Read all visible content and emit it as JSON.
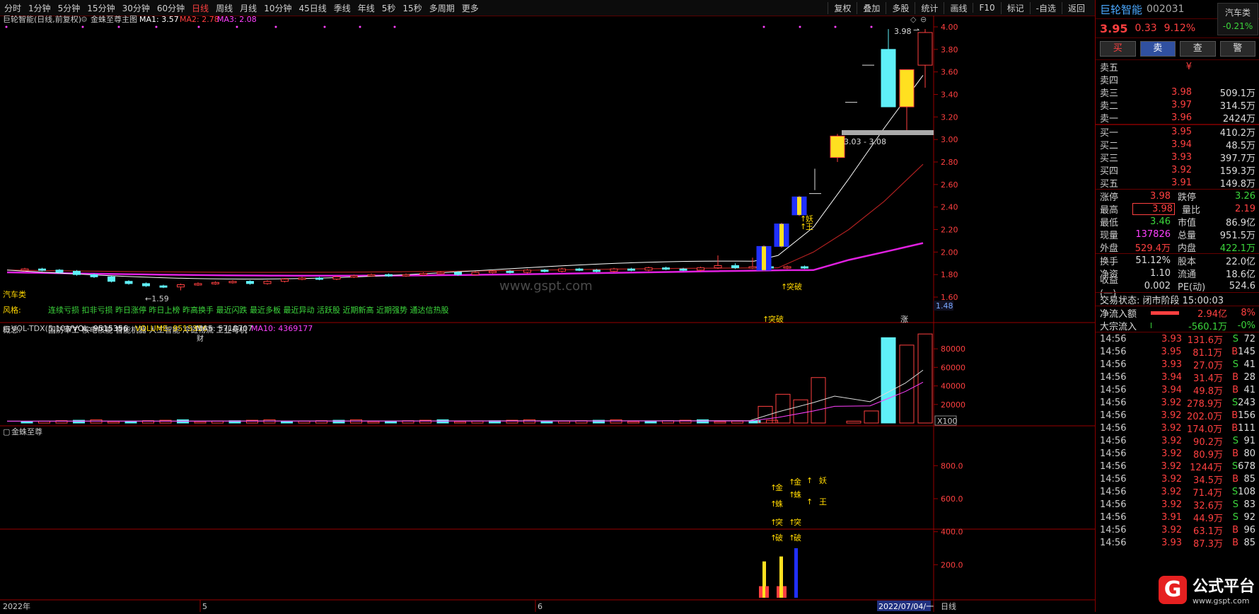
{
  "toolbar": {
    "tabs": [
      "分时",
      "1分钟",
      "5分钟",
      "15分钟",
      "30分钟",
      "60分钟",
      "日线",
      "周线",
      "月线",
      "10分钟",
      "45日线",
      "季线",
      "年线",
      "5秒",
      "15秒",
      "多周期",
      "更多"
    ],
    "active_tab": "日线",
    "tools": [
      "复权",
      "叠加",
      "多股",
      "统计",
      "画线",
      "F10",
      "标记",
      "-自选",
      "返回"
    ]
  },
  "main_chart": {
    "title": "巨轮智能(日线,前复权)",
    "indicator": "金蛛至尊主图",
    "ma1": "MA1: 3.57",
    "ma2": "MA2: 2.78",
    "ma3": "MA3: 2.08",
    "price_axis": [
      "4.00",
      "3.80",
      "3.60",
      "3.40",
      "3.20",
      "3.00",
      "2.80",
      "2.60",
      "2.40",
      "2.20",
      "2.00",
      "1.80",
      "1.60"
    ],
    "axis_low": "1.48",
    "peak_label": "3.98",
    "low_label": "←1.59",
    "range_label": "3.03 - 3.08",
    "sector_label": "汽车类",
    "style_label": "风格:",
    "style_tags": "连续亏损 扣非亏损 昨日涨停 昨日上榜 昨高换手 最近闪跌 最近多板 最近异动 活跃股 近期新高 近期强势 通达信热股",
    "concept_label": "概念:",
    "concept_tags": "国防军工 核电核能 智能机器 人工智能 冷链物流 工业母机",
    "concept_extra": "财",
    "signal_breakout": "突破",
    "signal_demon": "妖",
    "signal_king": "王",
    "signal_rise": "涨",
    "watermark": "www.gspt.com"
  },
  "volume_chart": {
    "title": "VOL-TDX(5,10)",
    "vvol": "VVOL: 9515356",
    "volume": "VOLUME: 9515356",
    "ma5": "MA5: 5718707",
    "ma10": "MA10: 4369177",
    "axis": [
      "80000",
      "60000",
      "40000",
      "20000"
    ],
    "unit": "X100"
  },
  "lower_chart": {
    "title": "金蛛至尊",
    "axis": [
      "800.0",
      "600.0",
      "400.0",
      "200.0"
    ],
    "sig_jin": "金",
    "sig_zhu": "蛛",
    "sig_tu": "突",
    "sig_po": "破",
    "sig_yao": "妖",
    "sig_wang": "王"
  },
  "date_axis": {
    "start": "2022年",
    "m5": "5",
    "m6": "6",
    "end": "2022/07/04/一",
    "period": "日线"
  },
  "stock": {
    "name": "巨轮智能",
    "code": "002031",
    "price": "3.95",
    "change": "0.33",
    "pct": "9.12%",
    "sector": "汽车类",
    "sector_pct": "-0.21%"
  },
  "trade_buttons": [
    "买",
    "卖",
    "查",
    "警"
  ],
  "order_book": {
    "sell": [
      {
        "label": "卖五",
        "price": "¥",
        "vol": ""
      },
      {
        "label": "卖四",
        "price": "",
        "vol": ""
      },
      {
        "label": "卖三",
        "price": "3.98",
        "vol": "509.1万"
      },
      {
        "label": "卖二",
        "price": "3.97",
        "vol": "314.5万"
      },
      {
        "label": "卖一",
        "price": "3.96",
        "vol": "2424万"
      }
    ],
    "buy": [
      {
        "label": "买一",
        "price": "3.95",
        "vol": "410.2万"
      },
      {
        "label": "买二",
        "price": "3.94",
        "vol": "48.5万"
      },
      {
        "label": "买三",
        "price": "3.93",
        "vol": "397.7万"
      },
      {
        "label": "买四",
        "price": "3.92",
        "vol": "159.3万"
      },
      {
        "label": "买五",
        "price": "3.91",
        "vol": "149.8万"
      }
    ]
  },
  "stats": [
    {
      "a": "涨停",
      "b": "3.98",
      "c": "跌停",
      "d": "3.26"
    },
    {
      "a": "最高",
      "b": "3.98",
      "c": "量比",
      "d": "2.19"
    },
    {
      "a": "最低",
      "b": "3.46",
      "c": "市值",
      "d": "86.9亿"
    },
    {
      "a": "现量",
      "b": "137826",
      "c": "总量",
      "d": "951.5万"
    },
    {
      "a": "外盘",
      "b": "529.4万",
      "c": "内盘",
      "d": "422.1万"
    },
    {
      "a": "换手",
      "b": "51.12%",
      "c": "股本",
      "d": "22.0亿"
    },
    {
      "a": "净资",
      "b": "1.10",
      "c": "流通",
      "d": "18.6亿"
    },
    {
      "a": "收益(一)",
      "b": "0.002",
      "c": "PE(动)",
      "d": "524.6"
    }
  ],
  "trade_status": {
    "label": "交易状态: 闭市阶段 15:00:03"
  },
  "flows": [
    {
      "label": "净流入额",
      "value": "2.94亿",
      "pct": "8%"
    },
    {
      "label": "大宗流入",
      "value": "-560.1万",
      "pct": "-0%"
    }
  ],
  "ticks": [
    {
      "t": "14:56",
      "p": "3.93",
      "v": "131.6万",
      "s": "S",
      "n": "72"
    },
    {
      "t": "14:56",
      "p": "3.95",
      "v": "81.1万",
      "s": "B",
      "n": "145"
    },
    {
      "t": "14:56",
      "p": "3.93",
      "v": "27.0万",
      "s": "S",
      "n": "41"
    },
    {
      "t": "14:56",
      "p": "3.94",
      "v": "31.4万",
      "s": "B",
      "n": "28"
    },
    {
      "t": "14:56",
      "p": "3.94",
      "v": "49.8万",
      "s": "B",
      "n": "41"
    },
    {
      "t": "14:56",
      "p": "3.92",
      "v": "278.9万",
      "s": "S",
      "n": "243"
    },
    {
      "t": "14:56",
      "p": "3.92",
      "v": "202.0万",
      "s": "B",
      "n": "156"
    },
    {
      "t": "14:56",
      "p": "3.92",
      "v": "174.0万",
      "s": "B",
      "n": "111"
    },
    {
      "t": "14:56",
      "p": "3.92",
      "v": "90.2万",
      "s": "S",
      "n": "91"
    },
    {
      "t": "14:56",
      "p": "3.92",
      "v": "80.9万",
      "s": "B",
      "n": "80"
    },
    {
      "t": "14:56",
      "p": "3.92",
      "v": "1244万",
      "s": "S",
      "n": "678"
    },
    {
      "t": "14:56",
      "p": "3.92",
      "v": "34.5万",
      "s": "B",
      "n": "85"
    },
    {
      "t": "14:56",
      "p": "3.92",
      "v": "71.4万",
      "s": "S",
      "n": "108"
    },
    {
      "t": "14:56",
      "p": "3.92",
      "v": "32.6万",
      "s": "S",
      "n": "83"
    },
    {
      "t": "14:56",
      "p": "3.91",
      "v": "44.9万",
      "s": "S",
      "n": "92"
    },
    {
      "t": "14:56",
      "p": "3.92",
      "v": "63.1万",
      "s": "B",
      "n": "96"
    },
    {
      "t": "14:56",
      "p": "3.93",
      "v": "87.3万",
      "s": "B",
      "n": "85"
    }
  ],
  "logo": {
    "text": "公式平台",
    "url": "www.gspt.com",
    "mark": "G"
  }
}
